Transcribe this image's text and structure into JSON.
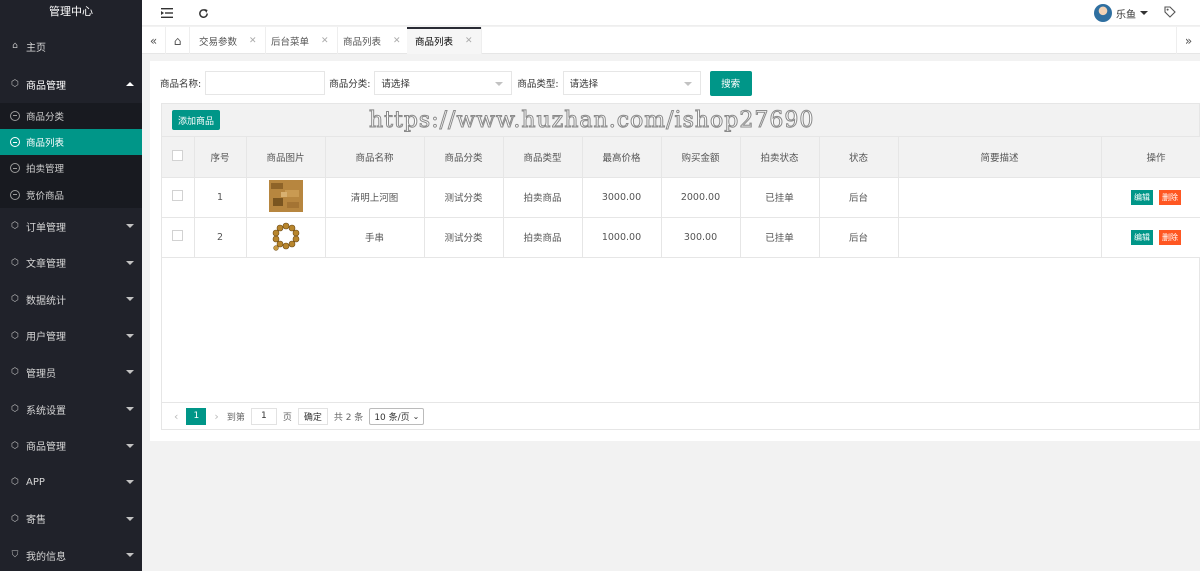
{
  "sidebar": {
    "title": "管理中心",
    "home": "主页",
    "open_group": "商品管理",
    "sub_items": [
      "商品分类",
      "商品列表",
      "拍卖管理",
      "竞价商品"
    ],
    "groups": [
      "订单管理",
      "文章管理",
      "数据统计",
      "用户管理",
      "管理员",
      "系统设置",
      "商品管理",
      "APP",
      "寄售",
      "我的信息"
    ]
  },
  "header": {
    "user_name": "乐鱼"
  },
  "tabs": [
    "交易参数",
    "后台菜单",
    "商品列表",
    "商品列表"
  ],
  "search": {
    "name_label": "商品名称:",
    "name_value": "",
    "category_label": "商品分类:",
    "category_value": "请选择",
    "type_label": "商品类型:",
    "type_value": "请选择",
    "search_button": "搜索"
  },
  "toolbar": {
    "add_button": "添加商品",
    "watermark": "https://www.huzhan.com/ishop27690"
  },
  "table": {
    "columns": [
      "序号",
      "商品图片",
      "商品名称",
      "商品分类",
      "商品类型",
      "最高价格",
      "购买金额",
      "拍卖状态",
      "状态",
      "简要描述",
      "操作"
    ],
    "rows": [
      {
        "index": "1",
        "name": "清明上河图",
        "category": "测试分类",
        "type": "拍卖商品",
        "max_price": "3000.00",
        "buy_amount": "2000.00",
        "auction_status": "已挂单",
        "status": "后台",
        "desc": "",
        "image": "painting-thumbnail"
      },
      {
        "index": "2",
        "name": "手串",
        "category": "测试分类",
        "type": "拍卖商品",
        "max_price": "1000.00",
        "buy_amount": "300.00",
        "auction_status": "已挂单",
        "status": "后台",
        "desc": "",
        "image": "bracelet-thumbnail"
      }
    ],
    "edit_label": "编辑",
    "delete_label": "删除"
  },
  "pagination": {
    "current_page": "1",
    "goto_label": "到第",
    "goto_value": "1",
    "page_unit": "页",
    "confirm": "确定",
    "total": "共 2 条",
    "page_size": "10 条/页"
  },
  "colors": {
    "accent": "#009688",
    "danger": "#ff5722",
    "sidebar_bg": "#20222a"
  }
}
